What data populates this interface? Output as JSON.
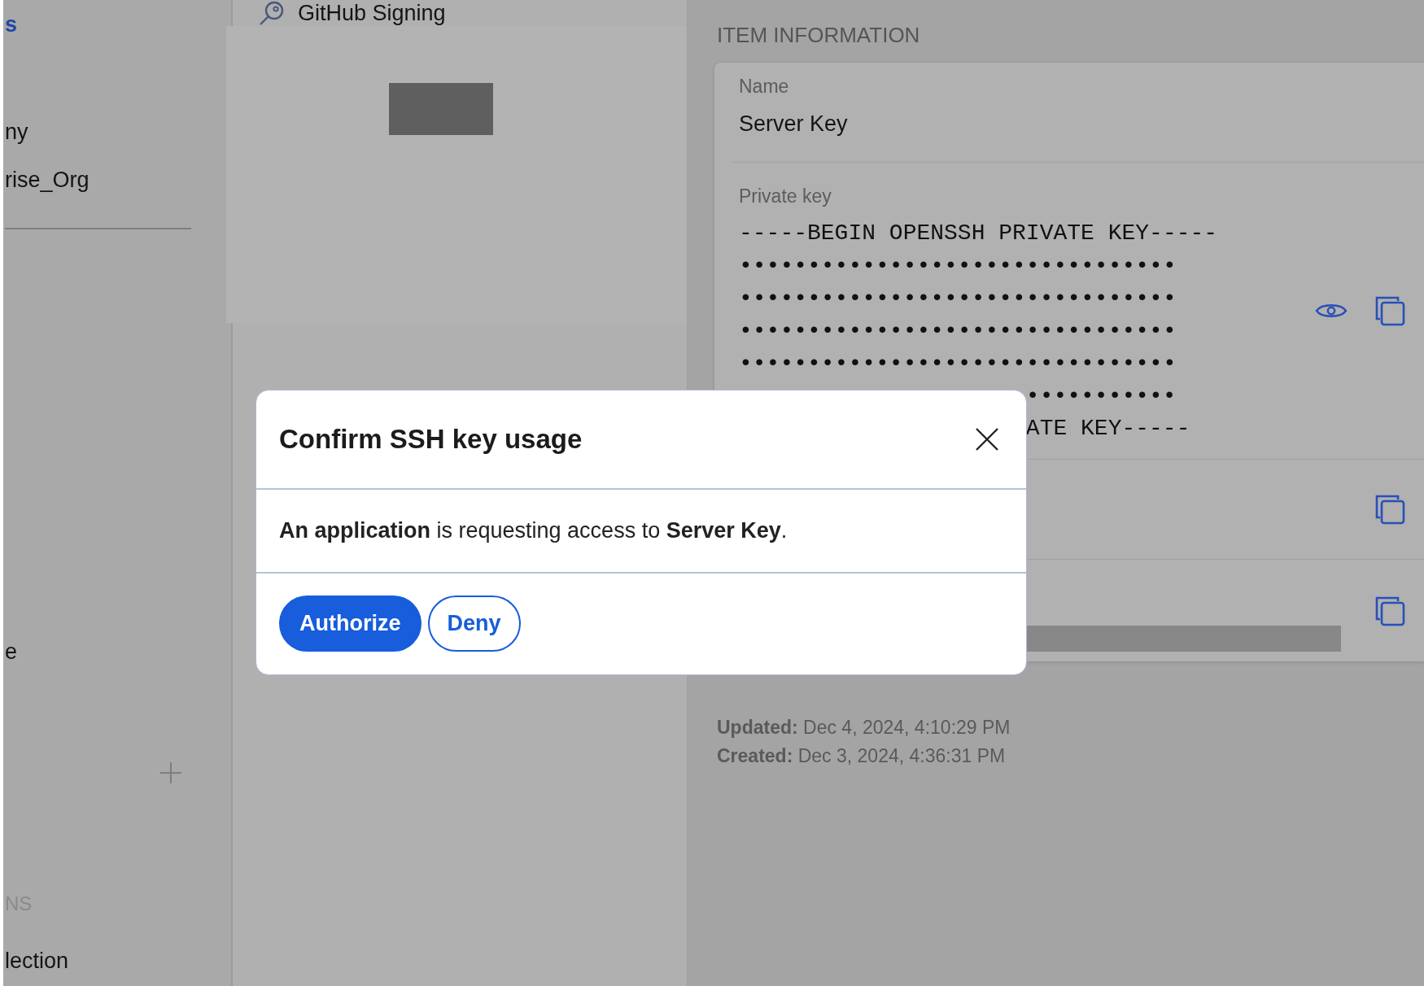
{
  "sidebar": {
    "items": [
      {
        "kind": "heading",
        "text": "s"
      },
      {
        "kind": "item",
        "text": "ny"
      },
      {
        "kind": "item",
        "text": "rise_Org"
      },
      {
        "kind": "divider"
      },
      {
        "kind": "item",
        "text": "e"
      },
      {
        "kind": "add"
      },
      {
        "kind": "section",
        "text": "NS"
      },
      {
        "kind": "item",
        "text": "lection"
      }
    ]
  },
  "vault_list": {
    "items": [
      {
        "name": "GitHub Signing"
      }
    ]
  },
  "item_information": {
    "heading": "ITEM INFORMATION",
    "fields": [
      {
        "kind": "text",
        "label": "Name",
        "value": "Server Key"
      },
      {
        "kind": "secret",
        "label": "Private key",
        "lines": [
          "-----BEGIN OPENSSH PRIVATE KEY-----",
          "••••••••••••••••••••••••••••••••",
          "••••••••••••••••••••••••••••••••",
          "••••••••••••••••••••••••••••••••",
          "••••••••••••••••••••••••••••••••"
        ],
        "partial_lines": [
          "•••••••••••",
          "ATE KEY-----"
        ]
      },
      {
        "kind": "covered"
      },
      {
        "kind": "covered",
        "redacted": true
      }
    ],
    "updated": {
      "label": "Updated:",
      "value": "Dec 4, 2024, 4:10:29 PM"
    },
    "created": {
      "label": "Created:",
      "value": "Dec 3, 2024, 4:36:31 PM"
    }
  },
  "dialog": {
    "title": "Confirm SSH key usage",
    "message": "**An application** is requesting access to **Server Key**.",
    "buttons": [
      {
        "kind": "primary",
        "label": "Authorize"
      },
      {
        "kind": "outline",
        "label": "Deny"
      }
    ]
  }
}
